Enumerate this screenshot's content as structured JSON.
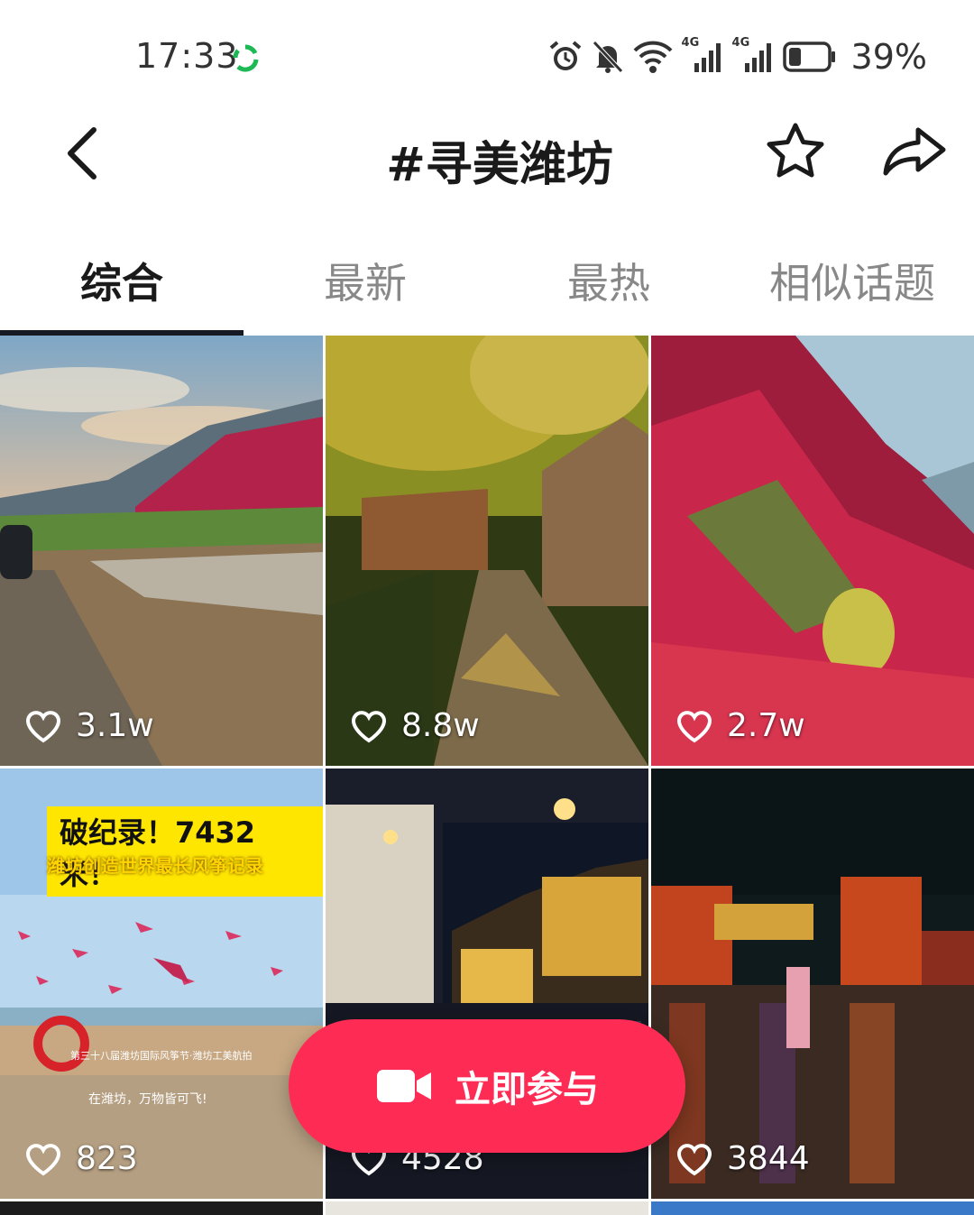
{
  "status_bar": {
    "time": "17:33",
    "battery": "39%",
    "network_labels": [
      "4G",
      "4G"
    ],
    "icons": [
      "alarm-icon",
      "mute-icon",
      "wifi-icon",
      "signal-icon",
      "signal-icon",
      "battery-icon"
    ],
    "battery_level": 0.39
  },
  "header": {
    "title": "#寻美潍坊",
    "icons": [
      "back-icon",
      "star-icon",
      "share-icon"
    ]
  },
  "tabs": [
    {
      "label": "综合",
      "active": true
    },
    {
      "label": "最新",
      "active": false
    },
    {
      "label": "最热",
      "active": false
    },
    {
      "label": "相似话题",
      "active": false
    }
  ],
  "grid": {
    "items": [
      {
        "likes": "3.1w",
        "scene": "mountain valley with red foliage and river"
      },
      {
        "likes": "8.8w",
        "scene": "stone path through autumn village"
      },
      {
        "likes": "2.7w",
        "scene": "red autumn mountain slope"
      },
      {
        "likes": "823",
        "title": "破纪录！7432米！",
        "subtitle": "潍坊创造世界最长风筝记录",
        "caption": "第三十八届潍坊国际风筝节·潍坊工美航拍",
        "slogan": "在潍坊，万物皆可飞!"
      },
      {
        "likes": "4528",
        "scene": "night view of lit ancient town"
      },
      {
        "likes": "3844",
        "scene": "rainy night plaza with lit archway"
      }
    ]
  },
  "join_button": {
    "label": "立即参与",
    "icon": "video-camera-icon",
    "color": "#fe2c55"
  },
  "colors": {
    "accent": "#fe2c55",
    "indicator": "#161823"
  }
}
